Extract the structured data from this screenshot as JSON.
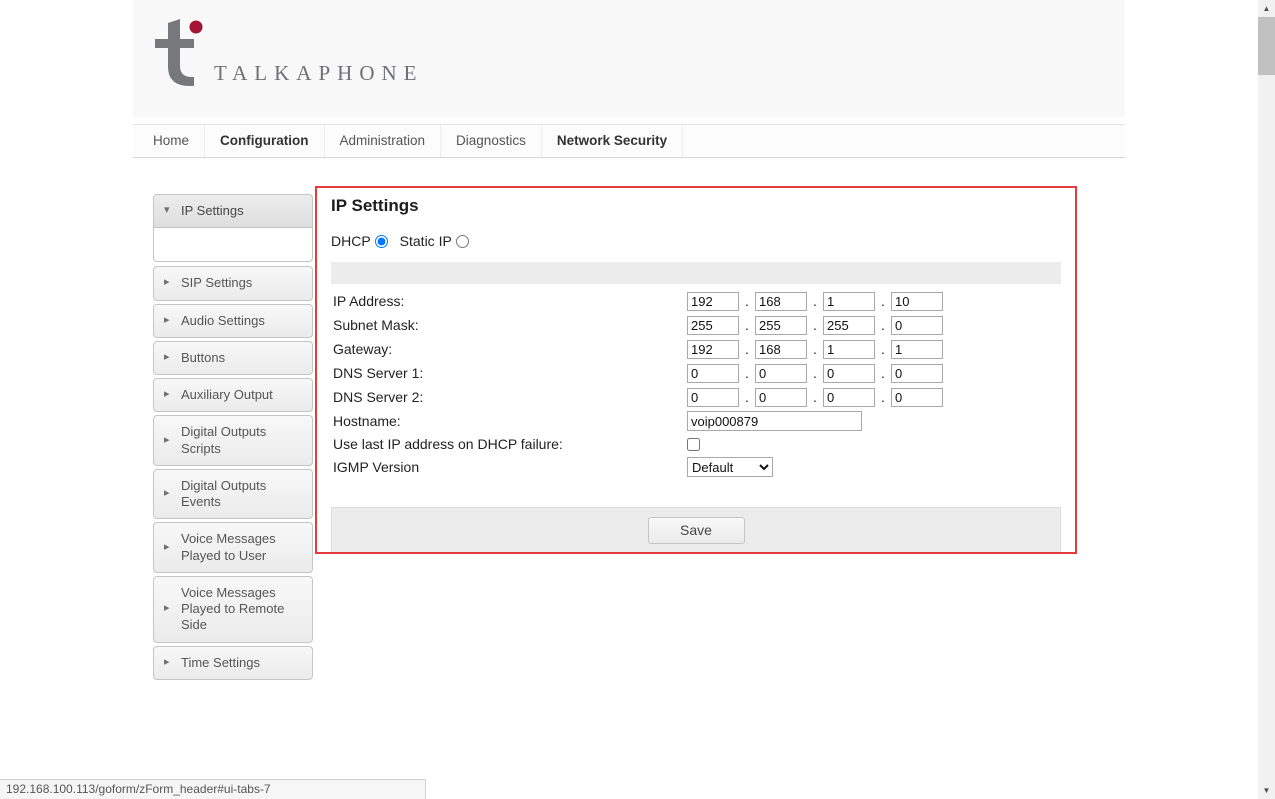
{
  "brand": {
    "name": "TALKAPHONE"
  },
  "colors": {
    "accent_red_border": "#e53b3b",
    "logo_gray": "#77787b",
    "logo_dot_red": "#a31335"
  },
  "nav": {
    "items": [
      {
        "label": "Home",
        "active": false
      },
      {
        "label": "Configuration",
        "active": true
      },
      {
        "label": "Administration",
        "active": false
      },
      {
        "label": "Diagnostics",
        "active": false
      },
      {
        "label": "Network Security",
        "active": false
      }
    ]
  },
  "sidebar": {
    "items": [
      {
        "label": "IP Settings",
        "expanded": true
      },
      {
        "label": "SIP Settings",
        "expanded": false
      },
      {
        "label": "Audio Settings",
        "expanded": false
      },
      {
        "label": "Buttons",
        "expanded": false
      },
      {
        "label": "Auxiliary Output",
        "expanded": false
      },
      {
        "label": "Digital Outputs Scripts",
        "expanded": false
      },
      {
        "label": "Digital Outputs Events",
        "expanded": false
      },
      {
        "label": "Voice Messages Played to User",
        "expanded": false
      },
      {
        "label": "Voice Messages Played to Remote Side",
        "expanded": false
      },
      {
        "label": "Time Settings",
        "expanded": false
      }
    ]
  },
  "main": {
    "title": "IP Settings",
    "dhcp_label": "DHCP",
    "static_label": "Static IP",
    "selected_mode": "DHCP",
    "dot": ".",
    "rows": [
      {
        "label": "IP Address:",
        "octets": [
          "192",
          "168",
          "1",
          "10"
        ]
      },
      {
        "label": "Subnet Mask:",
        "octets": [
          "255",
          "255",
          "255",
          "0"
        ]
      },
      {
        "label": "Gateway:",
        "octets": [
          "192",
          "168",
          "1",
          "1"
        ]
      },
      {
        "label": "DNS Server 1:",
        "octets": [
          "0",
          "0",
          "0",
          "0"
        ]
      },
      {
        "label": "DNS Server 2:",
        "octets": [
          "0",
          "0",
          "0",
          "0"
        ]
      }
    ],
    "hostname": {
      "label": "Hostname:",
      "value": "voip000879"
    },
    "dhcp_failure": {
      "label": "Use last IP address on DHCP failure:",
      "checked": false
    },
    "igmp": {
      "label": "IGMP Version",
      "value": "Default"
    },
    "save_label": "Save"
  },
  "statusbar": {
    "url": "192.168.100.113/goform/zForm_header#ui-tabs-7"
  }
}
